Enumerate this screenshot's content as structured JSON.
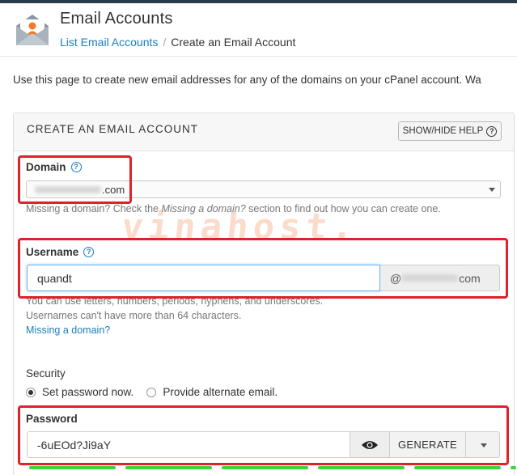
{
  "header": {
    "title": "Email Accounts",
    "breadcrumb_link": "List Email Accounts",
    "breadcrumb_separator": "/",
    "breadcrumb_current": "Create an Email Account"
  },
  "intro_text": "Use this page to create new email addresses for any of the domains on your cPanel account. Wa",
  "panel": {
    "title": "CREATE AN EMAIL ACCOUNT",
    "help_button": "SHOW/HIDE HELP"
  },
  "domain": {
    "label": "Domain",
    "selected_suffix": ".com",
    "hint_prefix": "Missing a domain? Check the ",
    "hint_emphasis": "Missing a domain?",
    "hint_suffix": " section to find out how you can create one."
  },
  "watermark": "vinahost.",
  "username": {
    "label": "Username",
    "value": "quandt",
    "addon_prefix": "@",
    "addon_suffix": "com",
    "hint_line1": "You can use letters, numbers, periods, hyphens, and underscores.",
    "hint_line2": "Usernames can't have more than 64 characters.",
    "missing_domain_link": "Missing a domain?"
  },
  "security": {
    "label": "Security",
    "option_set_password": "Set password now.",
    "option_alternate_email": "Provide alternate email.",
    "selected": "Set password now."
  },
  "password": {
    "label": "Password",
    "value": "-6uEOd?Ji9aY",
    "generate_button": "GENERATE",
    "strength_segments_filled": 6
  },
  "colors": {
    "link": "#1a7fc1",
    "highlight_box": "#e0202a",
    "strength_bar": "#3ed43e",
    "focus_border": "#66afe9"
  },
  "icons": {
    "app": "email-envelope-user-icon",
    "help": "question-circle-icon",
    "eye": "eye-icon",
    "dropdown": "caret-down-icon"
  }
}
